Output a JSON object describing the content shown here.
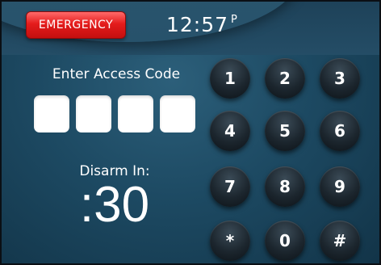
{
  "header": {
    "emergency_label": "EMERGENCY",
    "time": "12:57",
    "time_suffix": "P"
  },
  "access": {
    "prompt": "Enter Access Code",
    "code_length": 4
  },
  "disarm": {
    "label": "Disarm In:",
    "countdown": ":30"
  },
  "keypad": {
    "keys": [
      "1",
      "2",
      "3",
      "4",
      "5",
      "6",
      "7",
      "8",
      "9",
      "*",
      "0",
      "#"
    ]
  },
  "colors": {
    "emergency": "#e41c1c",
    "background": "#1d4a63",
    "key": "#1c262e"
  }
}
